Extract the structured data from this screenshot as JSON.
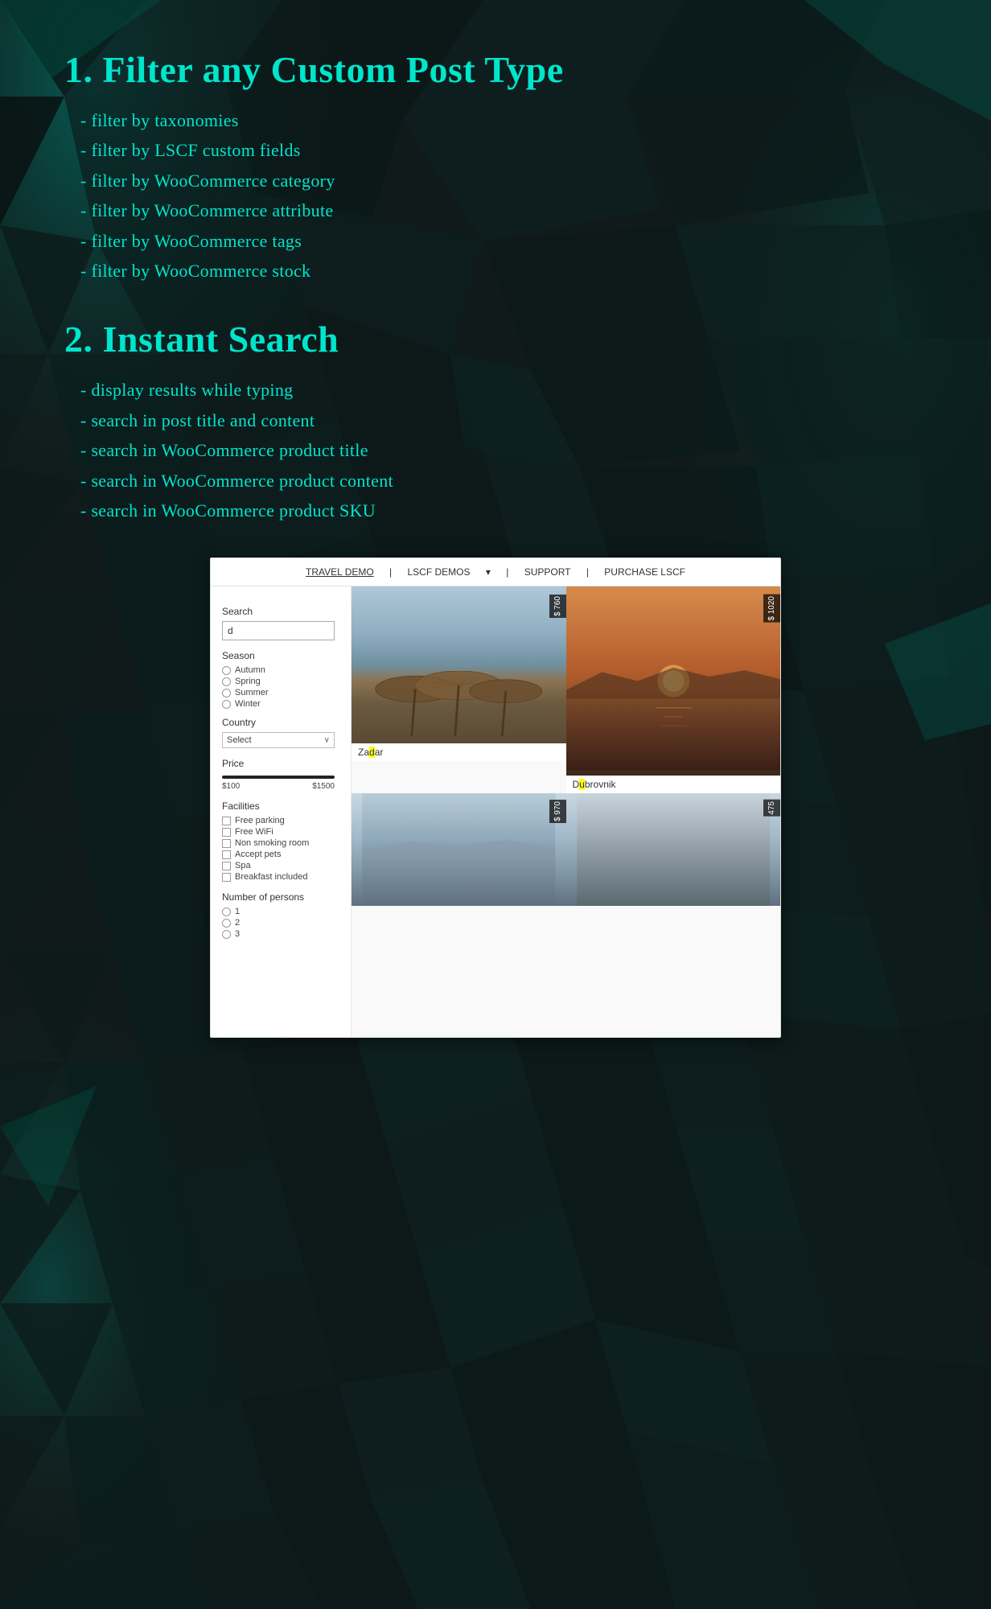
{
  "background": {
    "color": "#0d1a1a"
  },
  "section1": {
    "title": "1. Filter any Custom Post Type",
    "bullets": [
      "filter by taxonomies",
      "filter by LSCF custom fields",
      "filter by WooCommerce category",
      "filter by WooCommerce attribute",
      "filter by WooCommerce tags",
      "filter by WooCommerce stock"
    ]
  },
  "section2": {
    "title": "2. Instant Search",
    "bullets": [
      "display results while typing",
      "search in post title and content",
      "search in WooCommerce product title",
      "search in WooCommerce product content",
      "search in WooCommerce product SKU"
    ]
  },
  "demo": {
    "nav": {
      "items": [
        "TRAVEL DEMO",
        "LSCF DEMOS",
        "SUPPORT",
        "PURCHASE LSCF"
      ],
      "active": "TRAVEL DEMO",
      "separators": [
        "|",
        "|",
        "|"
      ]
    },
    "sidebar": {
      "search_label": "Search",
      "search_placeholder": "d",
      "season_label": "Season",
      "seasons": [
        "Autumn",
        "Spring",
        "Summer",
        "Winter"
      ],
      "country_label": "Country",
      "country_placeholder": "Select",
      "price_label": "Price",
      "price_min": "$100",
      "price_max": "$1500",
      "facilities_label": "Facilities",
      "facilities": [
        "Free parking",
        "Free WiFi",
        "Non smoking room",
        "Accept pets",
        "Spa",
        "Breakfast included"
      ],
      "persons_label": "Number of persons",
      "persons": [
        "1",
        "2",
        "3"
      ]
    },
    "cards": [
      {
        "id": "zadar",
        "title": "Za",
        "title_highlight": "d",
        "title_rest": "ar",
        "price": "$ 760",
        "type": "beach"
      },
      {
        "id": "dubrovnik",
        "title": "D",
        "title_highlight": "u",
        "title_rest": "brovnik",
        "price": "$ 1020",
        "type": "sunset"
      },
      {
        "id": "card3",
        "price": "$ 970",
        "type": "blue"
      },
      {
        "id": "card4",
        "price": "475",
        "type": "bottom"
      }
    ]
  }
}
